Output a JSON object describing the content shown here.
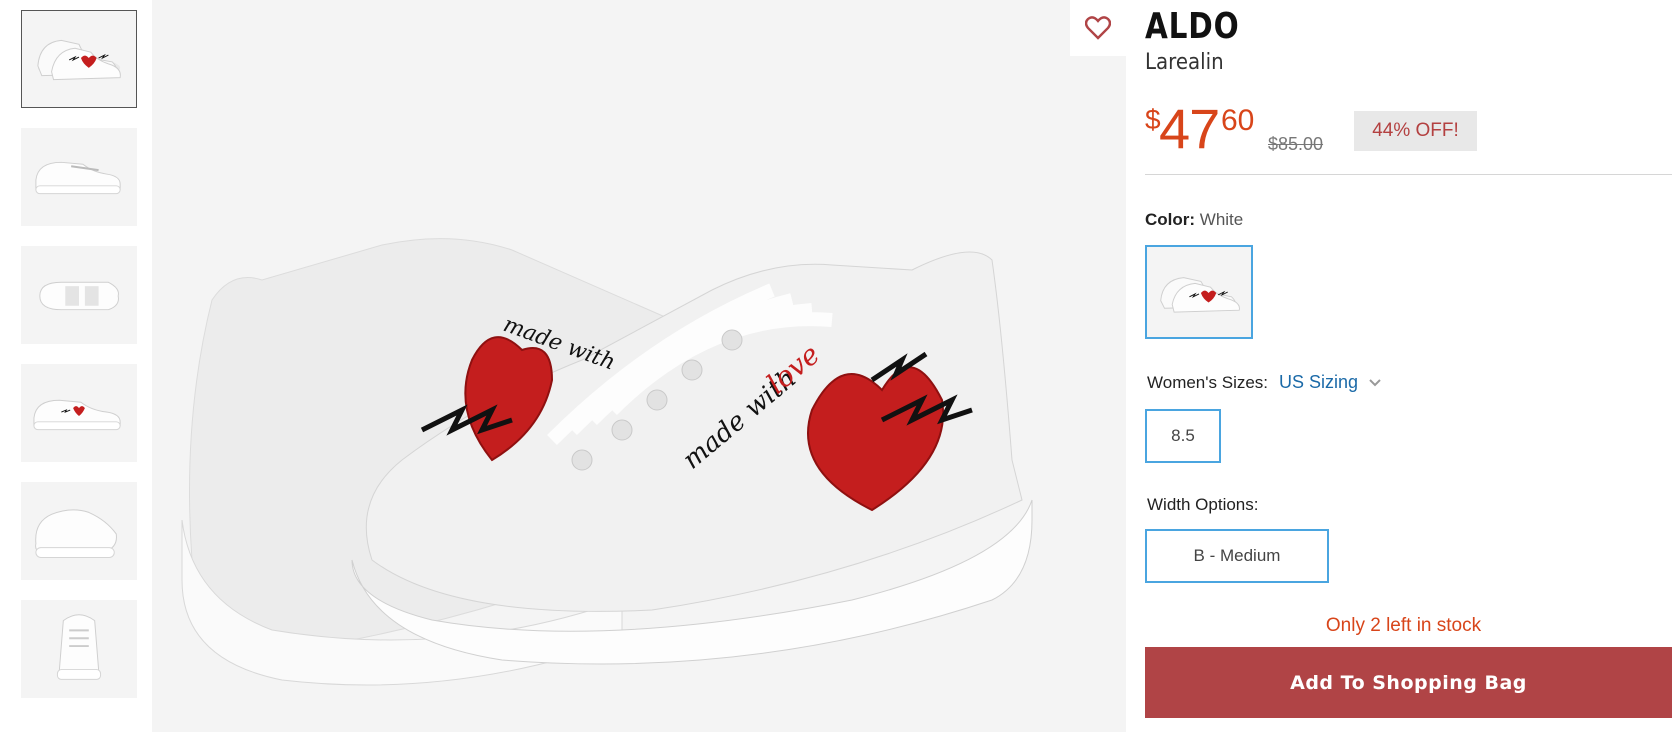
{
  "gallery": {
    "thumbnails": [
      {
        "view": "pair",
        "active": true
      },
      {
        "view": "side",
        "active": false
      },
      {
        "view": "sole",
        "active": false
      },
      {
        "view": "side-heart",
        "active": false
      },
      {
        "view": "back-three-quarter",
        "active": false
      },
      {
        "view": "front",
        "active": false
      }
    ],
    "main_image_alt": "made with love"
  },
  "favorite": {
    "icon": "heart-outline-icon",
    "color": "#b04446"
  },
  "product": {
    "brand": "ALDO",
    "name": "Larealin"
  },
  "price": {
    "currency": "$",
    "dollars": "47",
    "cents": "60",
    "original": "$85.00",
    "discount": "44% OFF!",
    "color": "#d8451a"
  },
  "color": {
    "label": "Color:",
    "value": "White"
  },
  "sizes": {
    "label": "Women's Sizes:",
    "sizing_link": "US Sizing",
    "selected": "8.5"
  },
  "width": {
    "label": "Width Options:",
    "selected": "B - Medium"
  },
  "stock": {
    "message": "Only 2 left in stock"
  },
  "cta": {
    "add_to_bag": "Add To Shopping Bag",
    "color": "#b04446"
  },
  "accent": {
    "selection_border": "#4aa5e0",
    "link": "#1b6aa8"
  }
}
